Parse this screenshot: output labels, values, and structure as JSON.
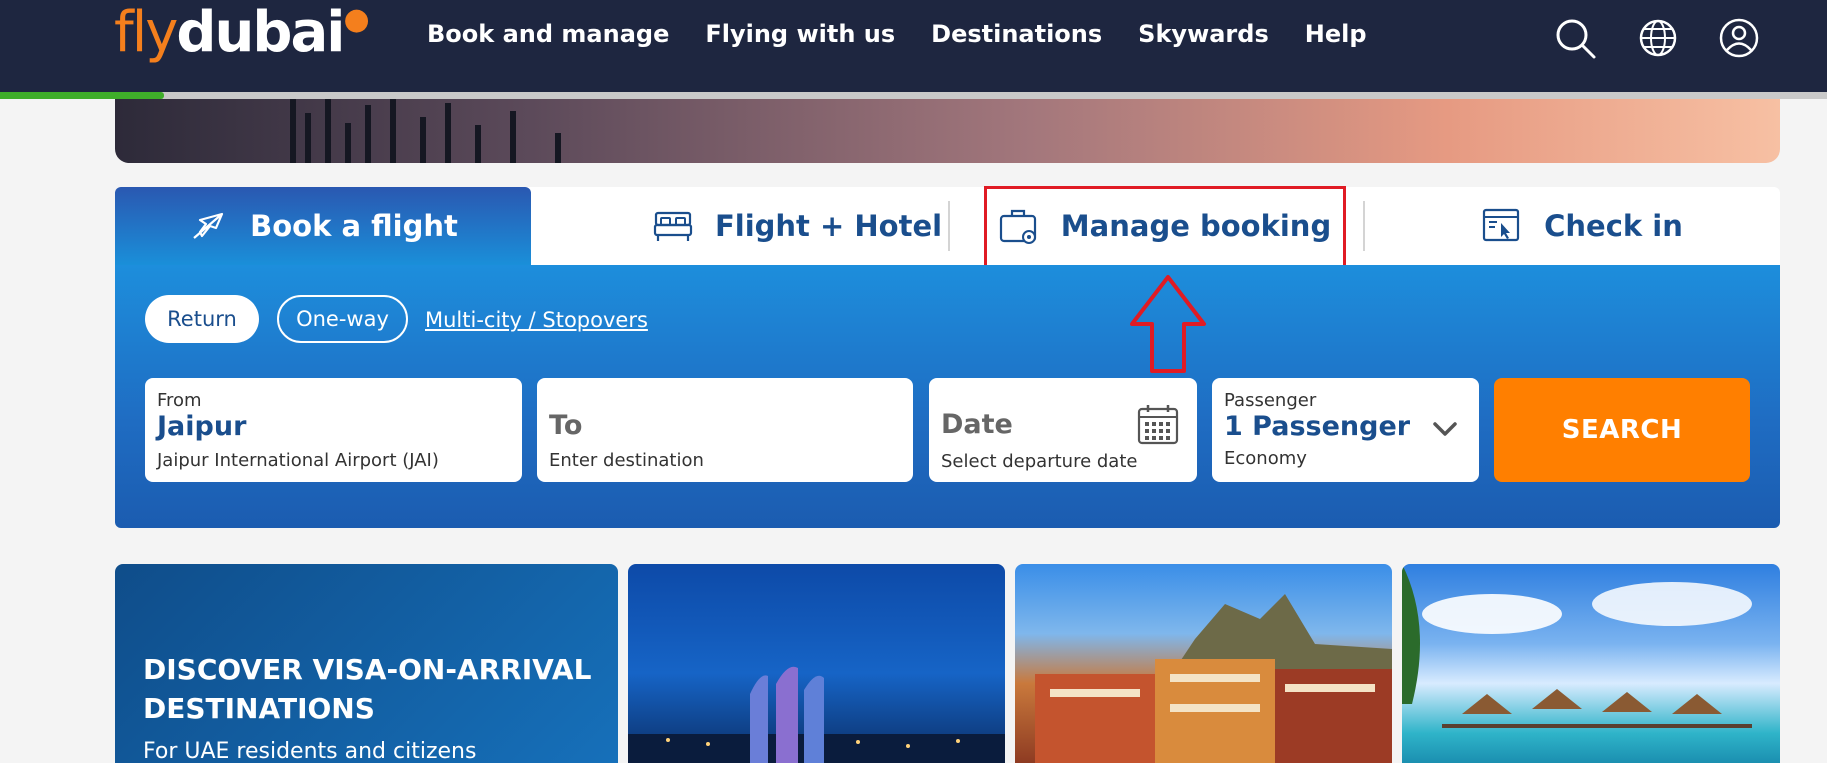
{
  "header": {
    "logo_fly": "fly",
    "logo_dubai": "dubai",
    "nav": [
      "Book and manage",
      "Flying with us",
      "Destinations",
      "Skywards",
      "Help"
    ],
    "icons": [
      "search-icon",
      "globe-icon",
      "user-icon"
    ],
    "page_load_progress": 0.09
  },
  "tabs": [
    {
      "label": "Book a flight",
      "icon": "plane-icon",
      "active": true
    },
    {
      "label": "Flight + Hotel",
      "icon": "bed-icon",
      "active": false
    },
    {
      "label": "Manage booking",
      "icon": "briefcase-gear-icon",
      "active": false,
      "highlighted": true
    },
    {
      "label": "Check in",
      "icon": "browser-cursor-icon",
      "active": false
    }
  ],
  "trip_types": {
    "return": "Return",
    "one_way": "One-way",
    "multi_city": "Multi-city / Stopovers"
  },
  "fields": {
    "from": {
      "label": "From",
      "value": "Jaipur",
      "detail": "Jaipur International Airport (JAI)"
    },
    "to": {
      "label": "To",
      "placeholder": "Enter destination"
    },
    "date": {
      "label": "Date",
      "placeholder": "Select departure date"
    },
    "passenger": {
      "label": "Passenger",
      "value": "1 Passenger",
      "cabin": "Economy"
    }
  },
  "search_label": "SEARCH",
  "promos": {
    "card1_title": "DISCOVER VISA-ON-ARRIVAL DESTINATIONS",
    "card1_sub": "For UAE residents and citizens"
  },
  "colors": {
    "header_bg": "#1e2640",
    "brand_orange": "#f47f1d",
    "primary_blue": "#1a4e8d",
    "search_orange": "#ff7f00",
    "highlight_red": "#e01b24"
  }
}
